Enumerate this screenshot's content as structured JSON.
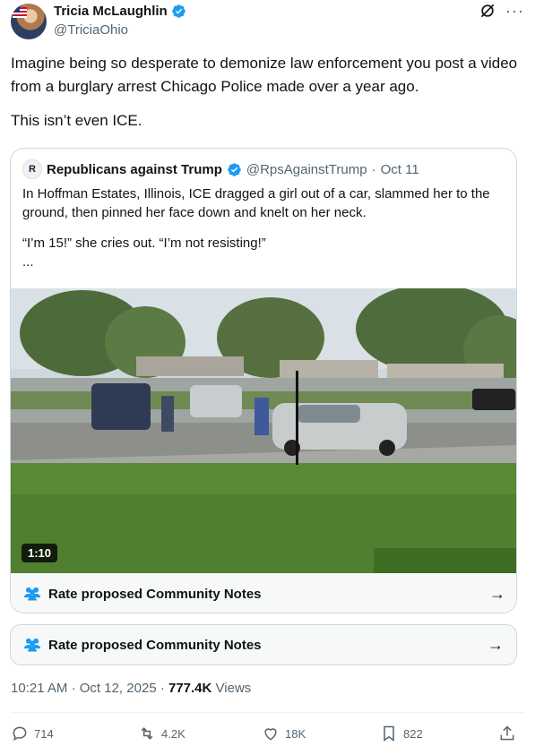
{
  "author": {
    "name": "Tricia McLaughlin",
    "handle": "@TriciaOhio"
  },
  "tweet": {
    "paragraphs": [
      "Imagine being so desperate to demonize law enforcement you post a video from a burglary arrest Chicago Police made over a year ago.",
      "This isn’t even ICE."
    ]
  },
  "quote": {
    "name": "Republicans against Trump",
    "handle": "@RpsAgainstTrump",
    "date": "Oct 11",
    "paragraphs": [
      "In Hoffman Estates, Illinois, ICE dragged a girl out of a car, slammed her to the ground, then pinned her face down and knelt on her neck.",
      "“I’m 15!” she cries out. “I’m not resisting!”"
    ],
    "more": "...",
    "video_duration": "1:10",
    "community_notes_label": "Rate proposed Community Notes"
  },
  "community_notes_label": "Rate proposed Community Notes",
  "meta": {
    "time": "10:21 AM",
    "date": "Oct 12, 2025",
    "views_count": "777.4K",
    "views_label": "Views"
  },
  "actions": {
    "replies": "714",
    "reposts": "4.2K",
    "likes": "18K",
    "bookmarks": "822"
  },
  "colors": {
    "verified": "#1d9bf0",
    "secondary_text": "#536471",
    "border": "#cfd9de"
  },
  "icons": [
    "verified-badge-icon",
    "grok-icon",
    "more-icon",
    "people-icon",
    "arrow-right-icon",
    "reply-icon",
    "repost-icon",
    "like-icon",
    "bookmark-icon",
    "share-icon"
  ]
}
